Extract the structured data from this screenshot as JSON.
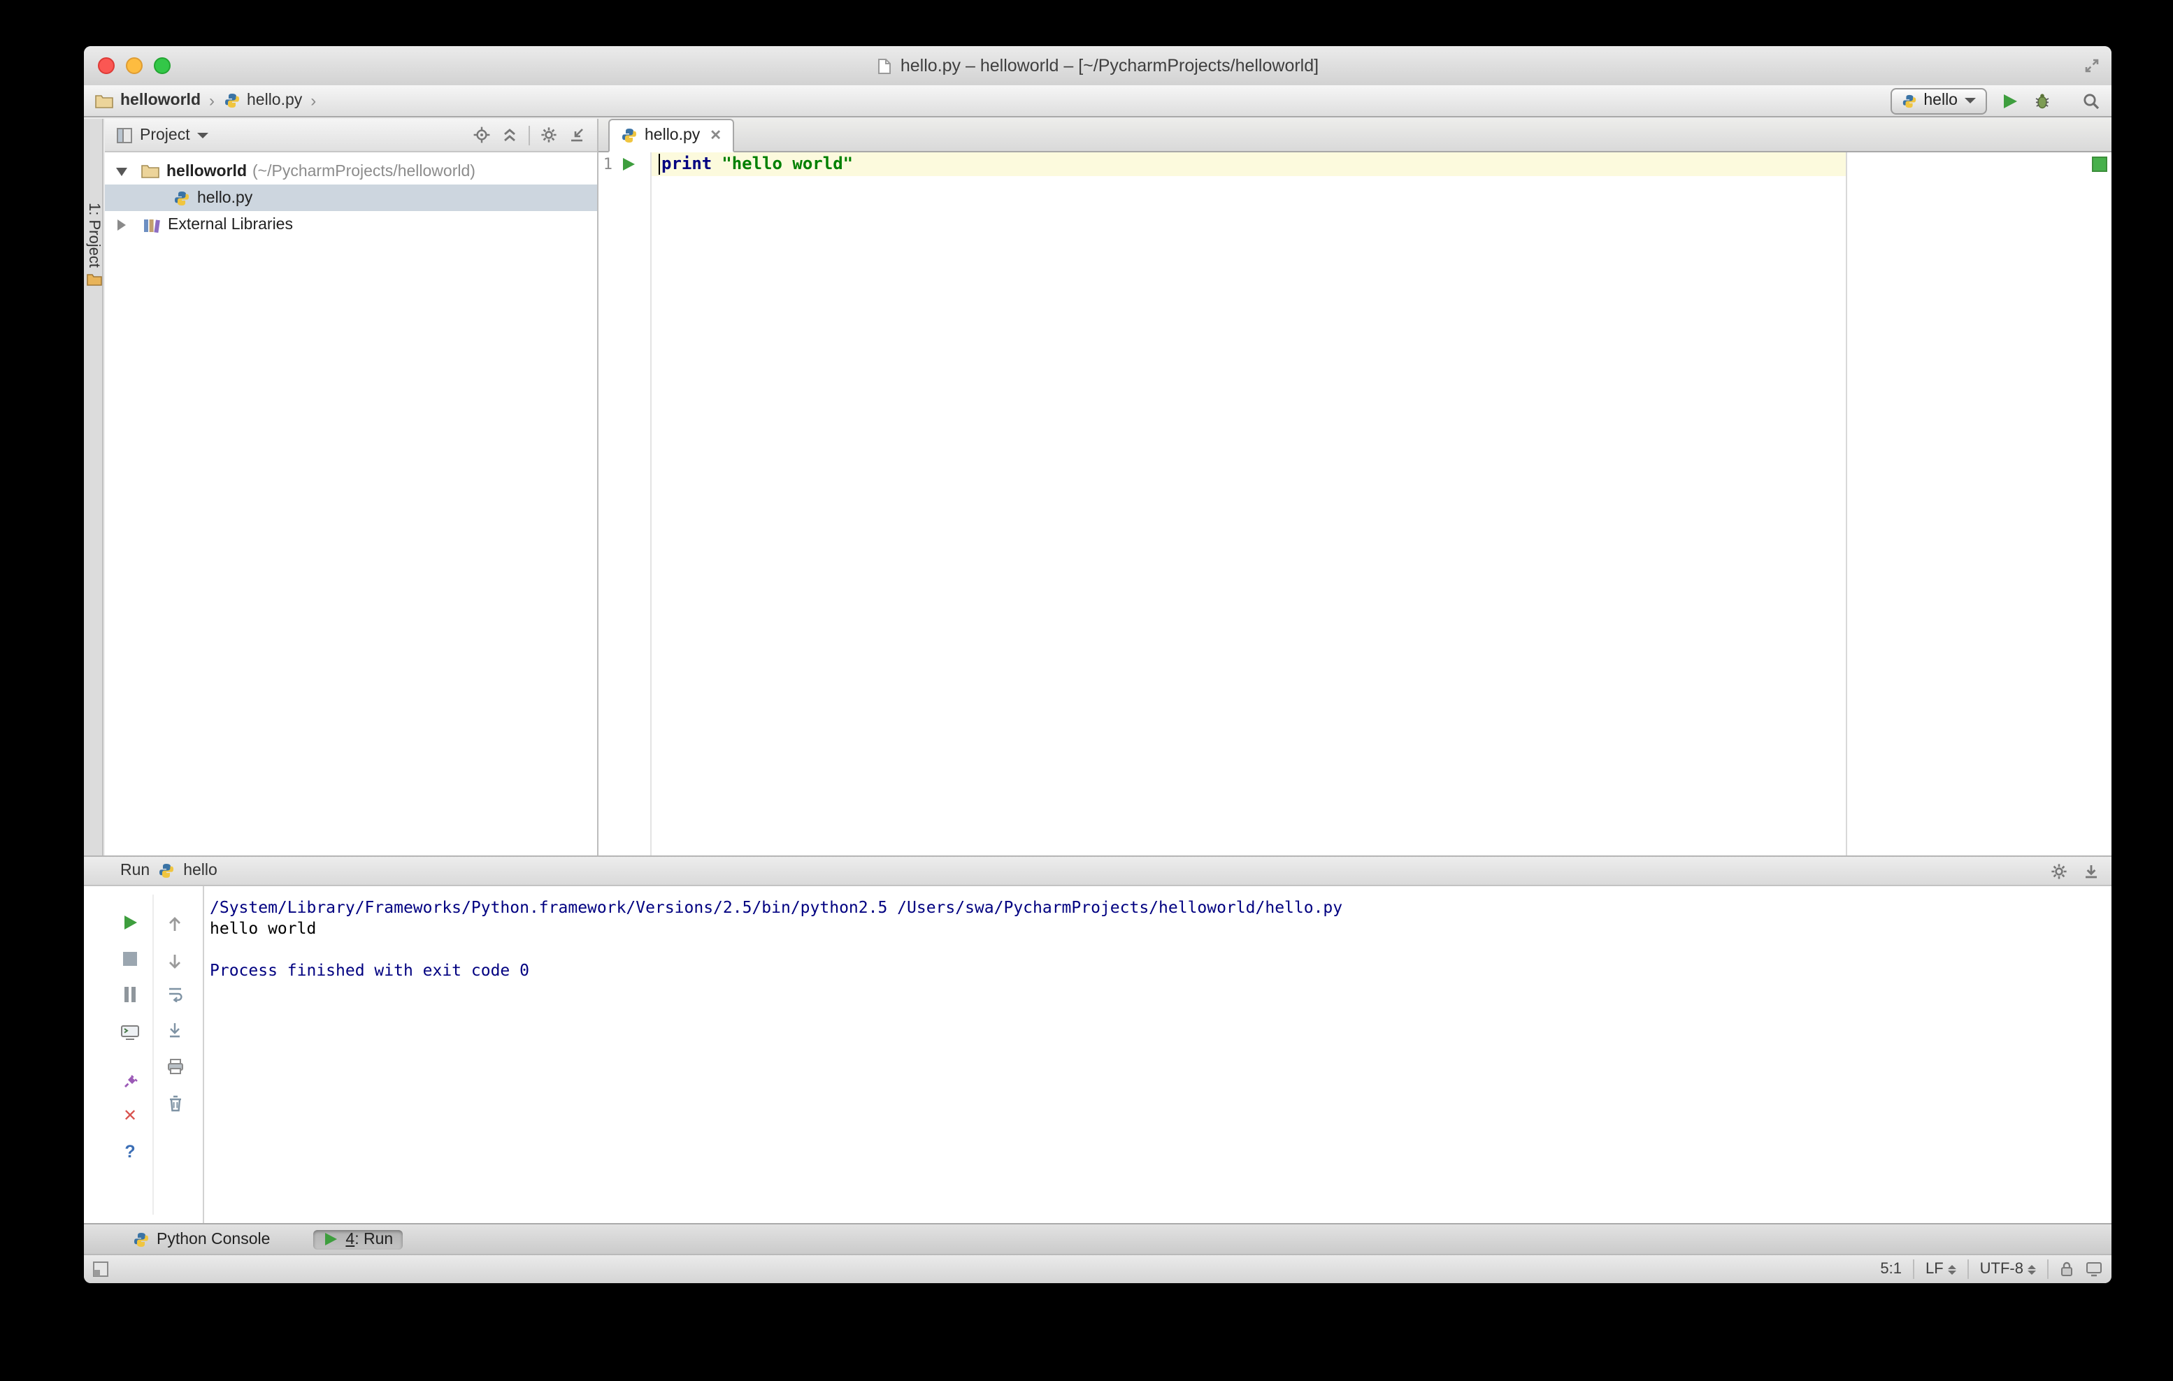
{
  "colors": {
    "run_green": "#3e9e3e",
    "selection_row": "#cdd6df",
    "caret_row": "#fcfadd",
    "keyword": "#000080",
    "string": "#008000",
    "console_system": "#000080",
    "inspection_ok": "#47b04b"
  },
  "titlebar": {
    "title": "hello.py – helloworld – [~/PycharmProjects/helloworld]"
  },
  "breadcrumb_bar": {
    "project": "helloworld",
    "file": "hello.py",
    "run_config": "hello"
  },
  "tool_stripe": {
    "project_tab": "1: Project"
  },
  "project_panel": {
    "header_label": "Project",
    "root_name": "helloworld",
    "root_path": "(~/PycharmProjects/helloworld)",
    "file": "hello.py",
    "external_libs": "External Libraries"
  },
  "editor": {
    "tab_label": "hello.py",
    "line_number": "1",
    "keyword": "print",
    "string_literal": "\"hello world\""
  },
  "run_panel": {
    "title": "Run",
    "config_name": "hello",
    "console": {
      "command_line": "/System/Library/Frameworks/Python.framework/Versions/2.5/bin/python2.5 /Users/swa/PycharmProjects/helloworld/hello.py",
      "output_line": "hello world",
      "exit_line": "Process finished with exit code 0"
    }
  },
  "bottom_bar": {
    "python_console_label": "Python Console",
    "run_tab_mnemonic": "4",
    "run_tab_suffix": ": Run"
  },
  "status_bar": {
    "caret_position": "5:1",
    "line_separator": "LF",
    "encoding": "UTF-8"
  }
}
